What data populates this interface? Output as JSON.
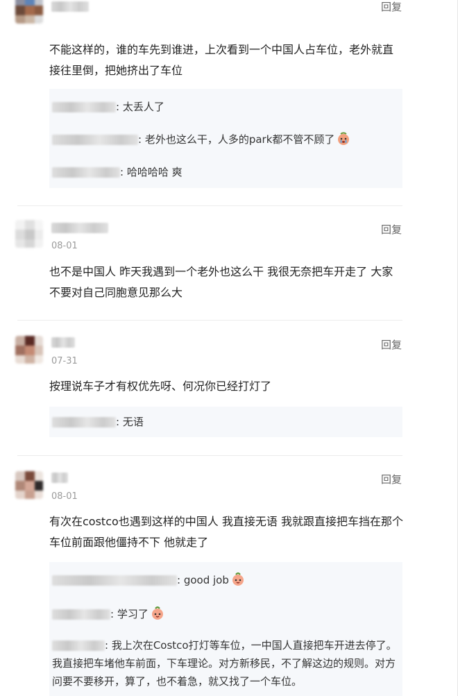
{
  "comments": [
    {
      "reply_label": "回复",
      "text": "不能这样的，谁的车先到谁进，上次看到一个中国人占车位，老外就直接往里倒，把她挤出了车位",
      "replies": [
        {
          "text": ": 太丢人了"
        },
        {
          "text": ": 老外也这么干，人多的park都不管不顾了",
          "emoji": "crying-face-icon"
        },
        {
          "text": ": 哈哈哈哈 爽"
        }
      ]
    },
    {
      "date": "08-01",
      "reply_label": "回复",
      "text": "也不是中国人 昨天我遇到一个老外也这么干 我很无奈把车开走了 大家不要对自己同胞意见那么大",
      "replies": []
    },
    {
      "date": "07-31",
      "reply_label": "回复",
      "text": "按理说车子才有权优先呀、何况你已经打灯了",
      "replies": [
        {
          "text": ": 无语"
        }
      ]
    },
    {
      "date": "08-01",
      "reply_label": "回复",
      "text": "有次在costco也遇到这样的中国人 我直接无语 我就跟直接把车挡在那个车位前面跟他僵持不下 他就走了",
      "replies": [
        {
          "text": ": good job",
          "emoji": "peach-face-icon"
        },
        {
          "text": ": 学习了",
          "emoji": "peach-face-icon"
        },
        {
          "text": ": 我上次在Costco打灯等车位，一中国人直接把车开进去停了。我直接把车堵他车前面，下车理论。对方新移民，不了解这边的规则。对方问要不要移开，算了，也不着急，就又找了一个车位。"
        }
      ]
    }
  ],
  "colors": {
    "reply_bg": "#f6f8fb",
    "separator": "#ececec",
    "meta_text": "#9a9a9a",
    "body_text": "#222222"
  }
}
